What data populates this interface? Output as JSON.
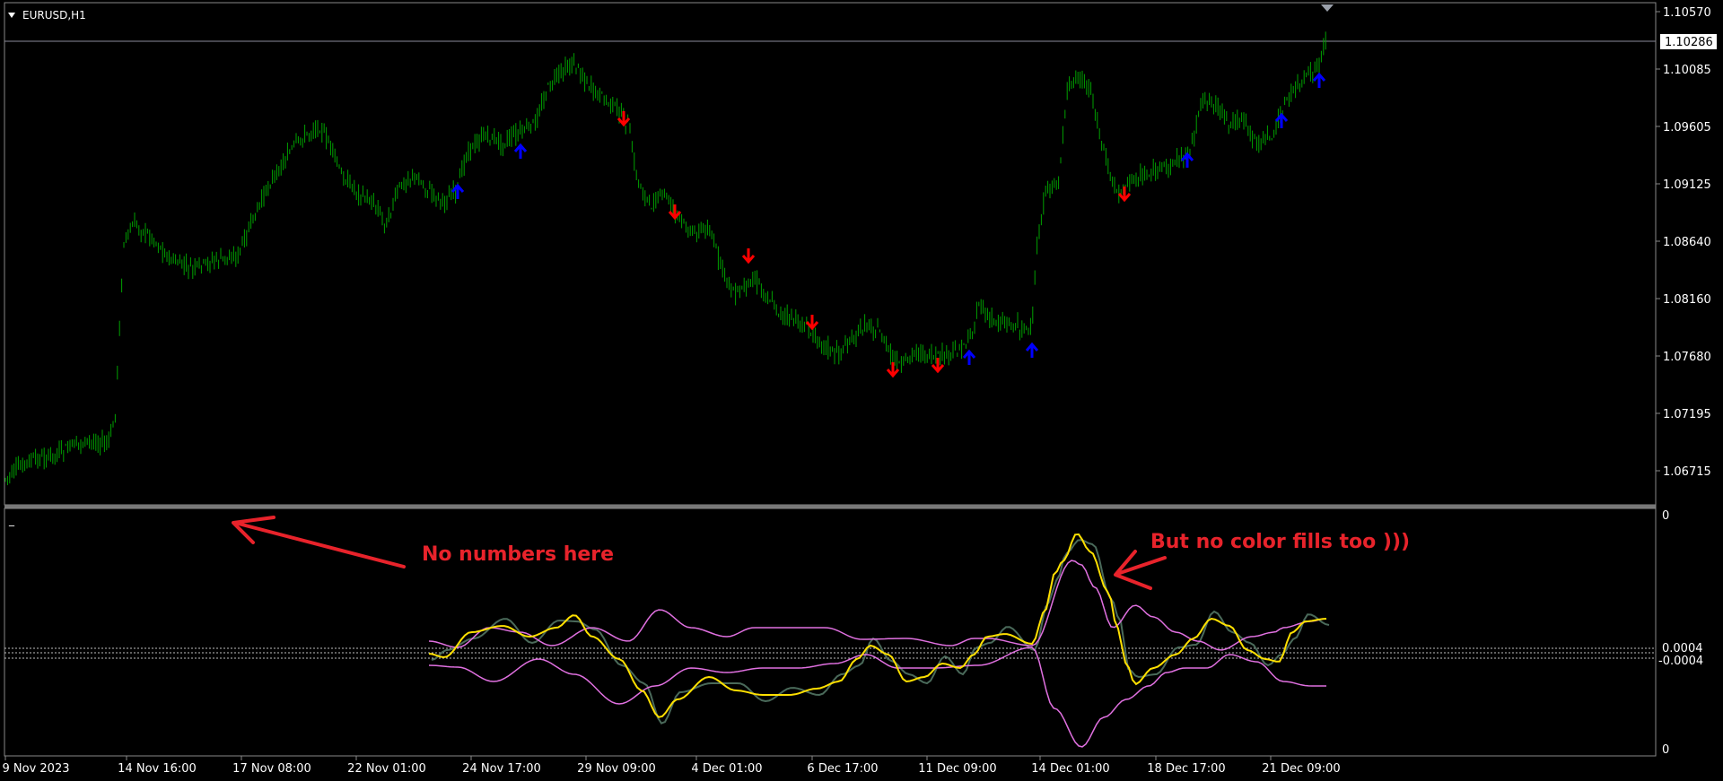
{
  "window": {
    "symbol_label": "EURUSD,H1",
    "dropdown_icon": "triangle-down-icon"
  },
  "price_axis": {
    "ticks": [
      "1.10570",
      "1.10085",
      "1.09605",
      "1.09125",
      "1.08640",
      "1.08160",
      "1.07680",
      "1.07195",
      "1.06715"
    ],
    "current_price": "1.10286",
    "scale_marker_icon": "triangle-down-icon"
  },
  "indicator_axis": {
    "top_label": "0",
    "level_upper": "0.0004",
    "level_lower": "-0.0004",
    "bottom_label": "0",
    "indicator_name": "_"
  },
  "time_axis": {
    "labels": [
      "9 Nov 2023",
      "14 Nov 16:00",
      "17 Nov 08:00",
      "22 Nov 01:00",
      "24 Nov 17:00",
      "29 Nov 09:00",
      "4 Dec 01:00",
      "6 Dec 17:00",
      "11 Dec 09:00",
      "14 Dec 01:00",
      "18 Dec 17:00",
      "21 Dec 09:00"
    ]
  },
  "annotations": {
    "left_text": "No numbers here",
    "right_text": "But no color fills too )))",
    "arrow_icon": "arrow-left-icon",
    "color": "#e8232b"
  },
  "colors": {
    "background": "#000000",
    "candles": "#00a000",
    "buy_arrow": "#0000ff",
    "sell_arrow": "#ff0000",
    "signal_line": "#ffe000",
    "band_line": "#e070e0",
    "oscillator_line": "#4a6a5a",
    "grid_level": "#c0c0c0"
  }
}
